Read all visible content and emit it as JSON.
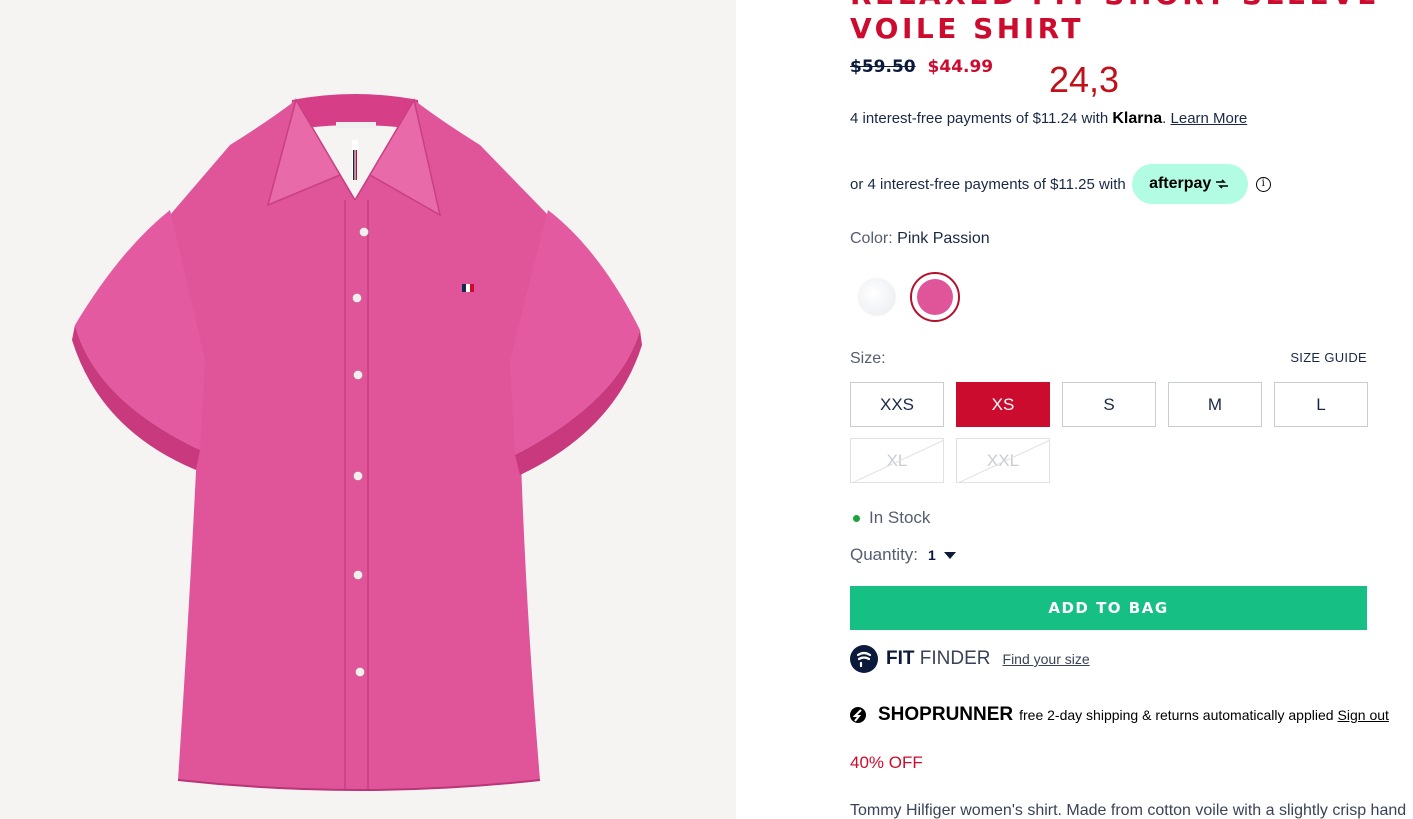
{
  "product": {
    "title_line1": "RELAXED FIT SHORT SLEEVE",
    "title_line2": "VOILE SHIRT",
    "price_original": "$59.50",
    "price_sale": "$44.99",
    "overlay_number": "24,3"
  },
  "klarna": {
    "text": "4 interest-free payments of $11.24 with",
    "brand": "Klarna",
    "link": "Learn More"
  },
  "afterpay": {
    "text": "or 4 interest-free payments of $11.25 with",
    "brand": "afterpay",
    "info_icon": "i"
  },
  "color": {
    "label": "Color:",
    "value": "Pink Passion",
    "swatches": [
      {
        "name": "white",
        "hex": "#ffffff"
      },
      {
        "name": "pink passion",
        "hex": "#e0549a",
        "selected": true
      }
    ]
  },
  "size": {
    "label": "Size:",
    "guide": "SIZE GUIDE",
    "options": [
      {
        "label": "XXS",
        "state": "available"
      },
      {
        "label": "XS",
        "state": "selected"
      },
      {
        "label": "S",
        "state": "available"
      },
      {
        "label": "M",
        "state": "available"
      },
      {
        "label": "L",
        "state": "available"
      },
      {
        "label": "XL",
        "state": "unavailable"
      },
      {
        "label": "XXL",
        "state": "unavailable"
      }
    ]
  },
  "stock": {
    "text": "In Stock",
    "color": "#1ca33a"
  },
  "quantity": {
    "label": "Quantity:",
    "value": "1"
  },
  "cart": {
    "add_label": "ADD TO BAG",
    "color": "#16bf84"
  },
  "fit_finder": {
    "brand_bold": "FIT",
    "brand_light": "FINDER",
    "link": "Find your size"
  },
  "shoprunner": {
    "brand": "SHOPRUNNER",
    "text": "free 2-day shipping & returns automatically applied",
    "link": "Sign out"
  },
  "discount": "40% OFF",
  "description": "Tommy Hilfiger women's shirt. Made from cotton voile with a slightly crisp hand",
  "theme": {
    "accent": "#cc0c2f",
    "navy": "#0b1a3a",
    "shirt": "#e0549a"
  }
}
